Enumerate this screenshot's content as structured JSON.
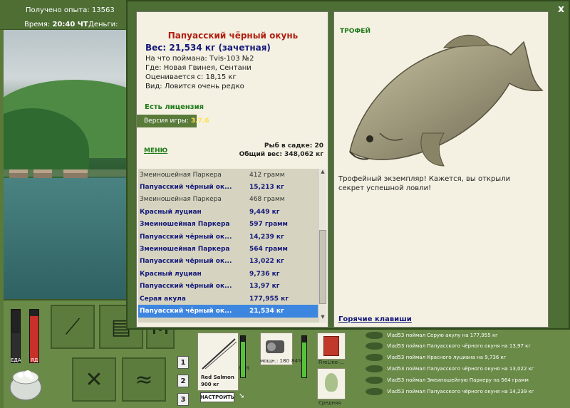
{
  "topbar": {
    "xp_label": "Получено опыта:",
    "xp_value": "13563",
    "time_label": "Время:",
    "time_value": "20:40 ЧТ",
    "money_label": "Деньги:"
  },
  "gauges": {
    "food_label": "ЕДА",
    "bait_label": "ЯД",
    "food_level": 0.55,
    "bait_level": 0.88,
    "food_color": "#2e2e2e",
    "bait_color": "#c8302a"
  },
  "rig_buttons": [
    "1",
    "2",
    "3"
  ],
  "modal": {
    "close_label": "x",
    "fish": {
      "name": "Папуасский чёрный окунь",
      "weight": "Вес: 21,534 кг (зачетная)",
      "caught_with": "На что поймана: Tvis-103 №2",
      "location": "Где: Новая Гвинея, Сентани",
      "rated_from": "Оценивается с: 18,15 кг",
      "kind": "Вид: Ловится очень редко"
    },
    "license": "Есть лицензия",
    "version_label": "Версия игры:",
    "version_value": "3.7.6",
    "menu_label": "МЕНЮ",
    "keepnet_count": "Рыб в садке: 20",
    "keepnet_total": "Общий вес: 348,062 кг",
    "catch_list": [
      {
        "name": "Змеиношейная Паркера",
        "weight": "412 грамм",
        "style": "plain"
      },
      {
        "name": "Папуасский чёрный ок...",
        "weight": "15,213 кг",
        "style": "bold"
      },
      {
        "name": "Змеиношейная Паркера",
        "weight": "468 грамм",
        "style": "plain"
      },
      {
        "name": "Красный луциан",
        "weight": "9,449 кг",
        "style": "bold"
      },
      {
        "name": "Змеиношейная Паркера",
        "weight": "597 грамм",
        "style": "bold"
      },
      {
        "name": "Папуасский чёрный ок...",
        "weight": "14,239 кг",
        "style": "bold"
      },
      {
        "name": "Змеиношейная Паркера",
        "weight": "564 грамм",
        "style": "bold"
      },
      {
        "name": "Папуасский чёрный ок...",
        "weight": "13,022 кг",
        "style": "bold"
      },
      {
        "name": "Красный луциан",
        "weight": "9,736 кг",
        "style": "bold"
      },
      {
        "name": "Папуасский чёрный ок...",
        "weight": "13,97 кг",
        "style": "bold"
      },
      {
        "name": "Серая акула",
        "weight": "177,955 кг",
        "style": "bold"
      },
      {
        "name": "Папуасский чёрный ок...",
        "weight": "21,534 кг",
        "style": "sel"
      }
    ],
    "trophy_label": "ТРОФЕЙ",
    "trophy_text": "Трофейный экземпляр! Кажется, вы открыли секрет успешной ловли!",
    "hotkeys": "Горячие клавиши"
  },
  "bottom": {
    "rod_percent": "87%",
    "rod_level": 0.87,
    "reel_caption": "мощн.: 180",
    "reel_percent": "84%",
    "reel_level": 0.84,
    "line_caption": "FireLine-...",
    "lure_caption": "Средняя",
    "bait_name": "Red Salmon",
    "bait_weight": "900 кг",
    "setup_button": "НАСТРОИТЬ"
  },
  "feed": [
    "Vlad53 поймал Серую акулу на 177,955 кг",
    "Vlad53 поймал Папуасского чёрного окуня на 13,97 кг",
    "Vlad53 поймал Красного луциана на 9,736 кг",
    "Vlad53 поймал Папуасского чёрного окуня на 13,022 кг",
    "Vlad53 поймал Змеиношейную Паркеру на 564 грамм",
    "Vlad53 поймал Папуасского чёрного окуня на 14,239 кг"
  ],
  "colors": {
    "accent_red": "#b11e10",
    "accent_blue": "#14187a",
    "accent_green": "#1f7a18",
    "selection": "#3d86e0"
  }
}
